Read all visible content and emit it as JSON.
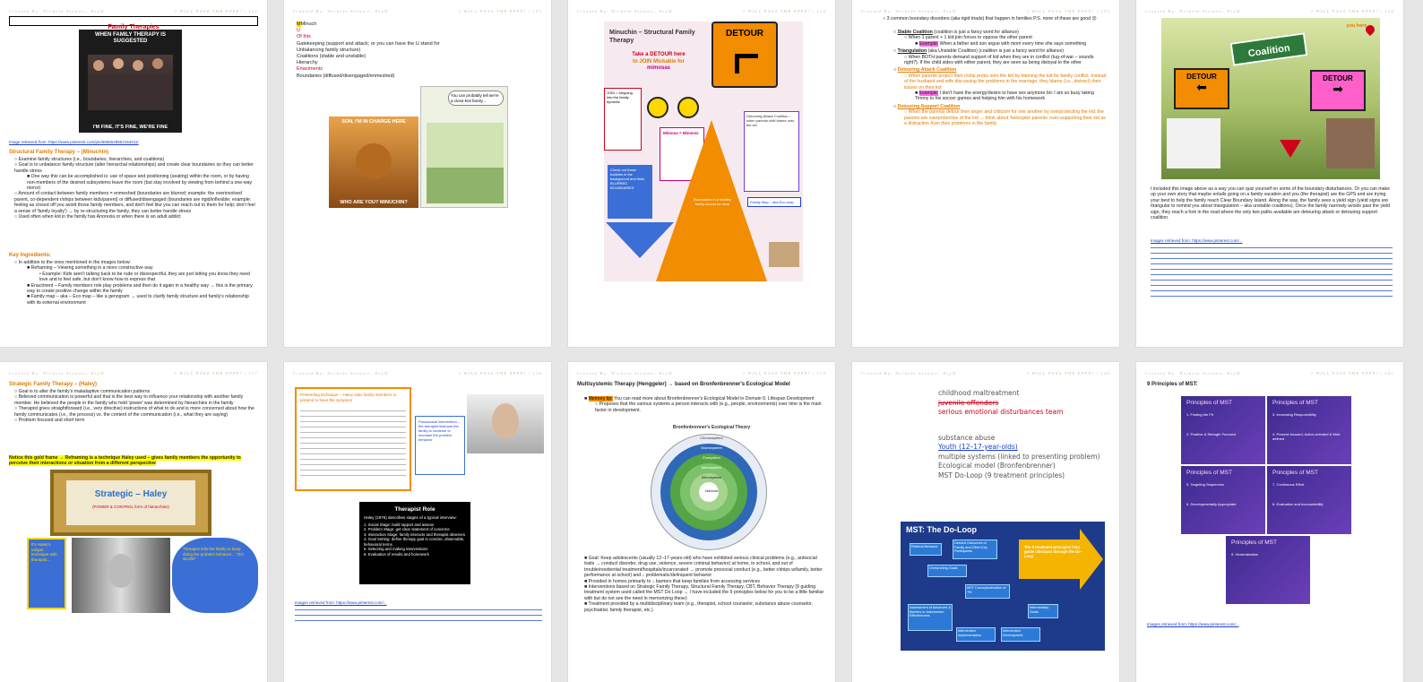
{
  "header": {
    "left": "Created By: Nichole Stewart, PsyD",
    "right": "I WILL PASS THE EPPP!"
  },
  "pages": [
    {
      "page_number": "132",
      "title": "Family Therapies",
      "meme_top": "WHEN FAMILY THERAPY IS SUGGESTED",
      "meme_bottom": "I'M FINE, IT'S FINE, WE'RE FINE",
      "image_ref": "Image retrieved from: https://www.pinterest.com/pin/5066549852154011/",
      "section_title": "Structural Family Therapy – (Minuchin)",
      "bullets": [
        "Examine family structures (i.e., boundaries, hierarchies, and coalitions)",
        "Goal is to unbalance family structure (alter hierarchal relationships) and create clear boundaries so they can better handle stress",
        "One way this can be accomplished is: use of space and positioning (seating) within the room, or by having non-members of the desired subsystems leave the room (but stay involved by viewing from behind a one-way mirror)",
        "Amount of contact between family members = enmeshed (boundaries are blurred; example: the overinvolved parent, co-dependent r/ships between kids/parent) or diffused/disengaged (boundaries are rigid/inflexible; example: feeling as closed off you avoid those family members, and don't feel like you can reach out to them for help; don't feel a sense of 'family loyalty') → by re-structuring the family, they can better handle stress",
        "Used often when kid in the family has Anorexia or when there is an adult addict"
      ],
      "key_title": "Key Ingredients:",
      "key_intro": "In addition to the ones mentioned in the images below:",
      "key_items": [
        "Reframing – Viewing something in a more constructive way",
        "Example: Kids aren't talking back to be rude or disrespectful, they are just letting you know they need love and to feel safe, but don't know how to express that",
        "Enactment – Family members role play problems and then do it again in a healthy way → this is the primary way to create positive change within the family",
        "Family map – aka – Eco map – like a genogram → used to clarify family structure and family's relationship with its external environment"
      ]
    },
    {
      "page_number": "133",
      "acronym": [
        "Minuch",
        "U",
        "Of this",
        "Gatekeeping (support and attack; or you can have the U stand for Unbalancing family structure)",
        "Coalitions (stable and unstable)",
        "Hierarchy",
        "Enactments",
        "Boundaries (diffused/disengaged/enmeshed)"
      ],
      "lion_top": "SON, I'M IN CHARGE HERE",
      "lion_bottom": "WHO ARE YOU? MINUCHIN?",
      "cartoon_caption": "You can probably tell we're a close-knit family..."
    },
    {
      "page_number": "134",
      "title": "Minuchin – Structural Family Therapy",
      "tagline_a": "Take a DETOUR here",
      "tagline_b": "to JOIN Mickable for",
      "tagline_c": "mimosas",
      "detour_sign": "DETOUR",
      "note_left": "JOIN = stepping into the family dynamic",
      "note_blue": "Check out these bubbles in the background and think BLURRED BOUNDARIES",
      "note_mid": "Mimosa = Mimesis",
      "note_tri": "Boundaries in a healthy family should be clear",
      "note_right": "Family Map – aka Eco-map",
      "note_detour": "Detouring-Attack Coalition – when parents shift blame onto the kid"
    },
    {
      "page_number": "135",
      "intro": "3 common boundary disorders (aka rigid triads) that happen in families P.S. none of these are good ☹",
      "items": [
        {
          "title": "Stable Coalition",
          "text": "(coalition is just a fancy word for alliance)"
        },
        {
          "title": "Triangulation",
          "text": "(aka Unstable Coalition) (coalition is just a fancy word for alliance)"
        },
        {
          "title": "Detouring-Attack Coalition",
          "text": "When parents project their r/ship probs onto the kid by blaming the kid for family conflict."
        },
        {
          "title": "Detouring-Support Coalition",
          "text": "When the parents detour their anger and criticism for one another by overprotecting the kid; the parents are overprotective of the kid → think about 'helicopter parents' over-supporting their kid as a distraction from their problems in the family"
        }
      ]
    },
    {
      "page_number": "136",
      "sign_coalition": "Coalition",
      "sign_detour_left": "DETOUR",
      "sign_detour_right": "DETOUR",
      "sign_here": "you here",
      "paragraph": "I included this image above as a way you can quiz yourself on some of the boundary disturbances. Or you can make up your own story that maybe entails going on a family vacation and you (the therapist) are the GPS and are trying your best to help the family reach Clear Boundary Island. Along the way, the family sees a yield sign (yield signs are triangular to remind you about triangulation – aka unstable coalitions). Once the family narrowly avoids past the yield sign, they reach a fork in the road where the only two paths available are detouring attack or detouring support coalition.",
      "image_ref": "Images retrieved from: https://www.pinterest.com/..."
    },
    {
      "page_number": "137",
      "section_title": "Strategic Family Therapy – (Haley)",
      "bullets": [
        "Goal is to alter the family's maladaptive communication patterns",
        "Believed communication is powerful and that is the best way to influence your relationship with another family member. He believed the people in the family who held 'power' was determined by hierarchies in the family",
        "Therapist gives straightforward (i.e., very directive) instructions of what to do and is more concerned about how the family communicates (i.e., the process) vs. the content of the communication (i.e., what they are saying)",
        "Problem focused and short term"
      ],
      "gold_note": "Notice this gold frame → Reframing is a technique Haley used – gives family members the opportunity to perceive their interactions or situation from a different perspective",
      "frame_title": "Strategic – Haley",
      "frame_sub": "(POWER & CONTROL form of hierarchies)",
      "bubble_left": "It's Haley's unique technique with therapist...",
      "bubble_right": "Therapist tells the family to keep doing the problem behavior... \"GO SLOW\""
    },
    {
      "page_number": "138",
      "box_text": "Pretending technique – Haley asks family members to pretend to have the symptom",
      "side_note": "Paradoxical intervention – the therapist instructs the family to continue or increase the problem behavior",
      "role_title": "Therapist Role",
      "role_intro": "Haley (1976) describes stages of a typical interview:",
      "role_items": [
        "Social Stage: build rapport and assess",
        "Problem Stage: get clear statement of concerns",
        "Interaction Stage: family interacts and therapist observes",
        "Goal Setting: define therapy goal in concise, observable, behavioral terms",
        "Selecting and making interventions",
        "Evaluation of results and homework"
      ],
      "image_ref": "Images retrieved from: https://www.pinterest.com/..."
    },
    {
      "page_number": "139",
      "section_title": "Multisystemic Therapy (Henggeler) → based on Bronfenbrenner's Ecological Model",
      "memory_tip": "Memory tip:",
      "lead": "You can read more about Bronfenbrenner's Ecological Model in Domain 6: Lifespan Development",
      "lead_sub": "Proposes that the various systems a person interacts with (e.g., people, environments) over time is the main factor in development.",
      "diagram_title": "Bronfenbrenner's Ecological Theory",
      "rings": [
        "Chronosystem",
        "Macrosystem",
        "Exosystem",
        "Mesosystem",
        "Microsystem",
        "Individual"
      ],
      "bullets": [
        "Goal: Keep adolescents (usually 12–17-years-old) who have exhibited serious clinical problems (e.g., antisocial traits → conduct disorder, drug use, violence, severe criminal behavior) at home, in school, and out of trouble/residential treatment/hospitals/incarcerated → promote prosocial conduct (e.g., better r/ships w/family, better performance at school) and ↓ problematic/delinquent behavior",
        "Provided in homes primarily to ↓ barriers that keep families from accessing services",
        "Interventions based on Strategic Family Therapy, Structural Family Therapy, CBT, Behavior Therapy (9 guiding treatment system used called the MST Do Loop → I have included the 9 principles below for you to be a little familiar with but do not see the need in memorizing these)",
        "Treatment provided by a multidisciplinary team (e.g., therapist, school counselor, substance abuse counselor, psychiatrist, family therapist, etc.)"
      ]
    },
    {
      "page_number": "140",
      "lines": [
        "childhood maltreatment",
        "juvenile offenders",
        "serious emotional disturbances team",
        "substance abuse",
        "Youth (12–17-year-olds)",
        "multiple systems (linked to presenting problem)",
        "Ecological model (Bronfenbrenner)",
        "MST Do-Loop (9 treatment principles)"
      ],
      "doloop_title": "MST: The Do-Loop",
      "doloop_boxes": [
        "Referral Behavior",
        "Desired Outcomes of Family and Other Key Participants",
        "Overarching Goals",
        "MST Conceptualization of 'Fit'",
        "Intermediary Goals",
        "Intervention Development",
        "Intervention Implementation",
        "Assessment of Advances & Barriers to Intervention Effectiveness"
      ],
      "arrow_text": "The 9 treatment principles help guide clinicians through the Do-Loop"
    },
    {
      "page_number": "141",
      "title": "9 Principles of MST:",
      "cards": [
        {
          "head": "Principles of MST",
          "items": [
            "1. Finding the Fit",
            "2. Positive & Strength Focused"
          ]
        },
        {
          "head": "Principles of MST",
          "items": [
            "3. Increasing Responsibility",
            "4. Present-focused, Action-oriented & Well-defined"
          ]
        },
        {
          "head": "Principles of MST",
          "items": [
            "5. Targeting Sequences",
            "6. Developmentally Appropriate"
          ]
        },
        {
          "head": "Principles of MST",
          "items": [
            "7. Continuous Effort",
            "8. Evaluation and Accountability"
          ]
        },
        {
          "head": "Principles of MST",
          "items": [
            "9. Generalization"
          ]
        }
      ],
      "image_ref": "Images retrieved from: https://www.pinterest.com/..."
    }
  ],
  "colors": {
    "accent_orange": "#e07b00",
    "link_blue": "#1a3fcf",
    "highlight_yellow": "#ffff00",
    "highlight_pink": "#ff66e8",
    "mst_purple": "#3d2b8f",
    "detour_orange": "#f28c00"
  }
}
